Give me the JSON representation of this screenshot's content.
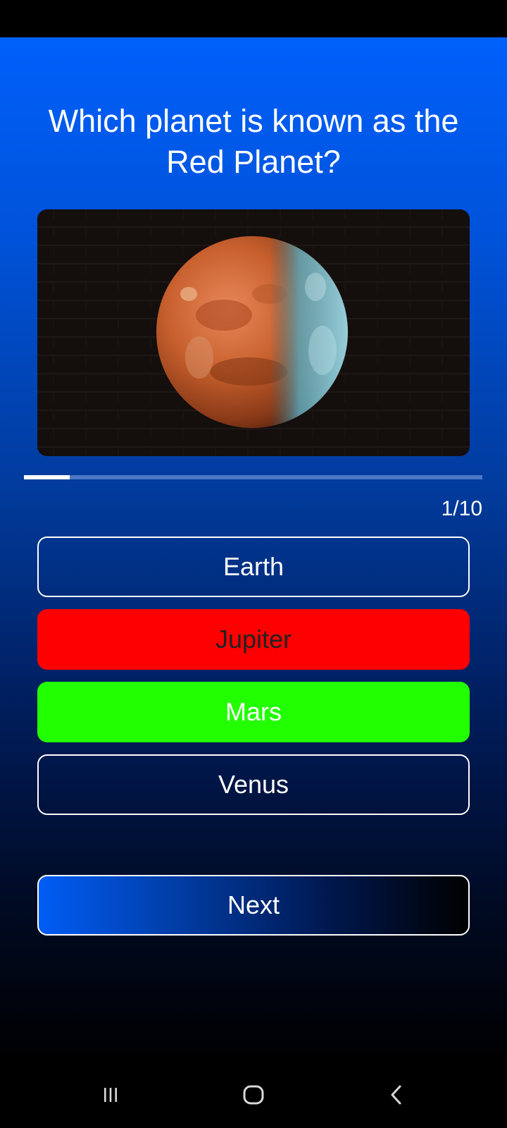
{
  "quiz": {
    "question": "Which planet is known as the Red Planet?",
    "image": "planet-image",
    "progress_fraction": 0.1,
    "counter": "1/10",
    "answers": [
      {
        "label": "Earth",
        "state": "neutral"
      },
      {
        "label": "Jupiter",
        "state": "wrong"
      },
      {
        "label": "Mars",
        "state": "correct"
      },
      {
        "label": "Venus",
        "state": "neutral"
      }
    ],
    "next_label": "Next"
  },
  "colors": {
    "background_top": "#0060fb",
    "background_bottom": "#000000",
    "wrong": "#ff0000",
    "correct": "#22ff00"
  },
  "nav": {
    "icons": [
      "recent-apps-icon",
      "home-icon",
      "back-icon"
    ]
  }
}
